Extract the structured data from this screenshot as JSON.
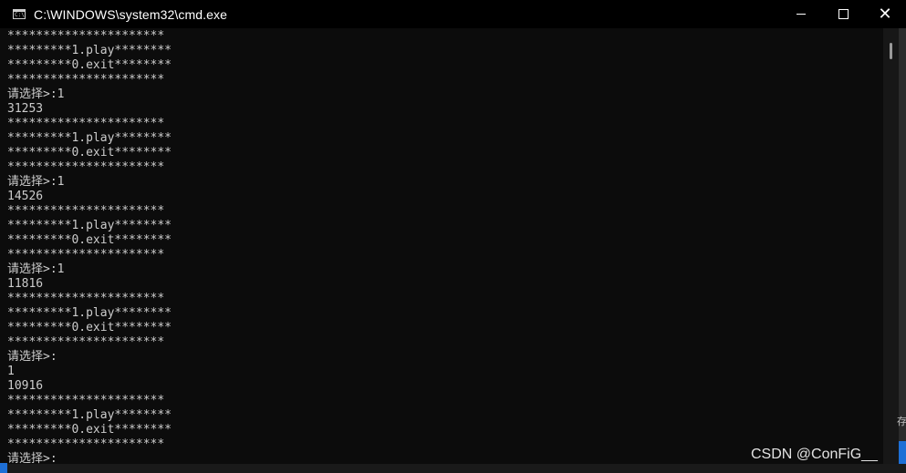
{
  "window": {
    "title": "C:\\WINDOWS\\system32\\cmd.exe",
    "icon": "cmd-icon",
    "icon_text": "C:\\"
  },
  "controls": {
    "minimize_icon": "minimize-icon",
    "maximize_icon": "maximize-icon",
    "close_icon": "close-icon",
    "close_glyph": "✕"
  },
  "console": {
    "lines": [
      "**********************",
      "*********1.play********",
      "*********0.exit********",
      "**********************",
      "请选择>:1",
      "31253",
      "**********************",
      "*********1.play********",
      "*********0.exit********",
      "**********************",
      "请选择>:1",
      "14526",
      "**********************",
      "*********1.play********",
      "*********0.exit********",
      "**********************",
      "请选择>:1",
      "11816",
      "**********************",
      "*********1.play********",
      "*********0.exit********",
      "**********************",
      "请选择>:",
      "1",
      "10916",
      "**********************",
      "*********1.play********",
      "*********0.exit********",
      "**********************",
      "请选择>:"
    ]
  },
  "background": {
    "partial_char": "存"
  },
  "watermark": "CSDN @ConFiG__",
  "colors": {
    "console_bg": "#0c0c0c",
    "console_text": "#cccccc",
    "titlebar_bg": "#000000",
    "accent": "#1e6fd6"
  }
}
